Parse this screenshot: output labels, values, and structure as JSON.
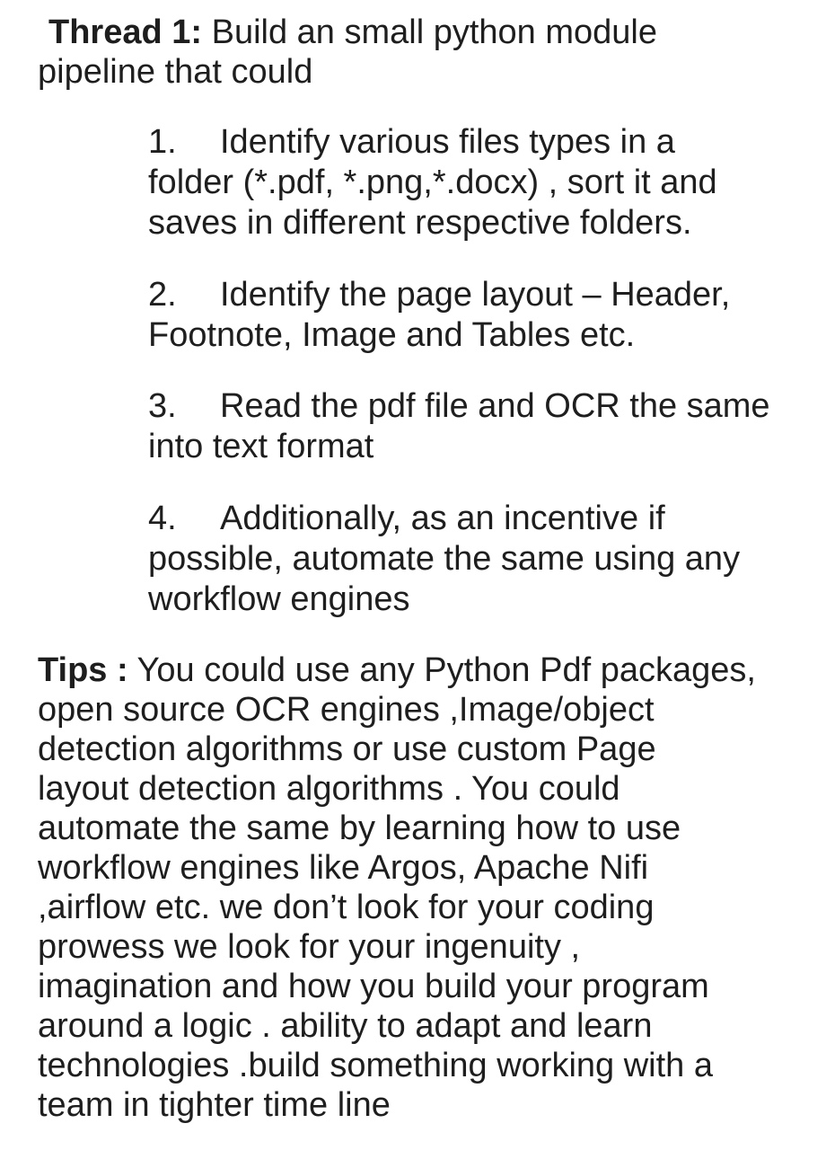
{
  "thread": {
    "label": "Thread 1:",
    "line1": "Build an small python module",
    "line2": "pipeline that could"
  },
  "items": [
    {
      "number": "1.",
      "lines": [
        "Identify various files types in a",
        "folder (*.pdf, *.png,*.docx) , sort it and",
        "saves  in different  respective folders."
      ]
    },
    {
      "number": "2.",
      "lines": [
        "Identify the page layout – Header,",
        "Footnote, Image and Tables etc."
      ]
    },
    {
      "number": "3.",
      "lines": [
        "Read the pdf file and OCR the same",
        "into text format"
      ]
    },
    {
      "number": "4.",
      "lines": [
        "Additionally, as an incentive if",
        "possible, automate the same using any",
        "workflow engines"
      ]
    }
  ],
  "tips": {
    "label": "Tips :",
    "lines": [
      "You could use any Python Pdf packages,",
      "open source OCR engines ,Image/object",
      "detection algorithms or  use custom Page",
      "layout detection algorithms . You could",
      "automate the same by learning how to use",
      "workflow engines like Argos, Apache Nifi",
      ",airflow etc. we don’t look for your coding",
      "prowess we look for your ingenuity ,",
      "imagination and how you build your program",
      "around a logic . ability to adapt and learn",
      "technologies .build something working with a",
      "team in tighter time line"
    ]
  }
}
